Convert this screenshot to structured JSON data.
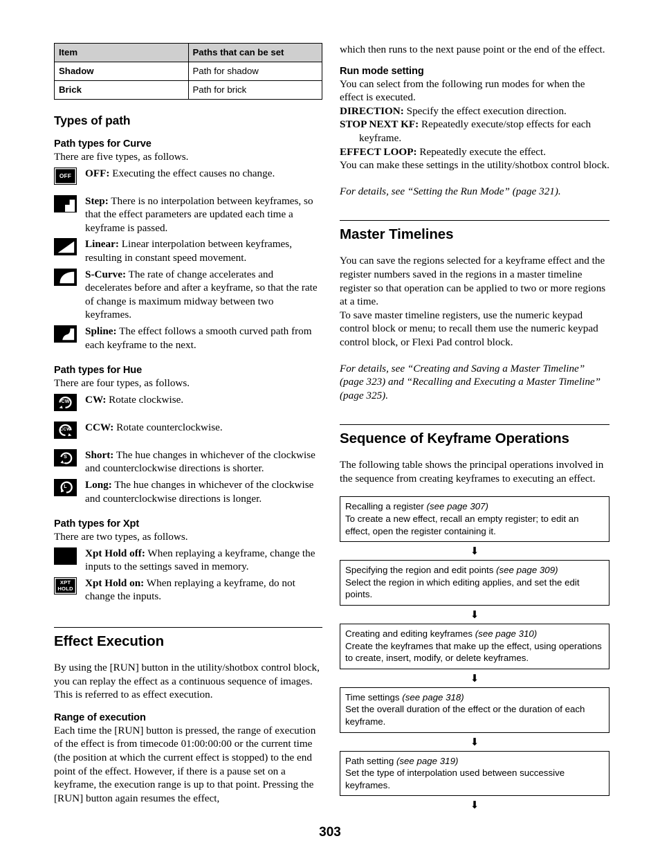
{
  "page_number": "303",
  "table": {
    "headers": [
      "Item",
      "Paths that can be set"
    ],
    "rows": [
      {
        "item": "Shadow",
        "paths": "Path for shadow"
      },
      {
        "item": "Brick",
        "paths": "Path for brick"
      }
    ]
  },
  "types_of_path": {
    "heading": "Types of path",
    "curve": {
      "heading": "Path types for Curve",
      "intro": "There are five types, as follows.",
      "items": [
        {
          "icon": "off-icon",
          "icon_label": "OFF",
          "term": "OFF:",
          "desc": " Executing the effect causes no change."
        },
        {
          "icon": "step-path-icon",
          "icon_label": "",
          "term": "Step:",
          "desc": " There is no interpolation between keyframes, so that the effect parameters are updated each time a keyframe is passed."
        },
        {
          "icon": "linear-path-icon",
          "icon_label": "",
          "term": "Linear:",
          "desc": " Linear interpolation between keyframes, resulting in constant speed movement."
        },
        {
          "icon": "s-curve-path-icon",
          "icon_label": "",
          "term": "S-Curve:",
          "desc": " The rate of change accelerates and decelerates before and after a keyframe, so that the rate of change is maximum midway between two keyframes."
        },
        {
          "icon": "spline-path-icon",
          "icon_label": "",
          "term": "Spline:",
          "desc": " The effect follows a smooth curved path from each keyframe to the next."
        }
      ]
    },
    "hue": {
      "heading": "Path types for Hue",
      "intro": "There are four types, as follows.",
      "items": [
        {
          "icon": "cw-rotate-icon",
          "icon_label": "CW",
          "term": "CW:",
          "desc": " Rotate clockwise."
        },
        {
          "icon": "ccw-rotate-icon",
          "icon_label": "CCW",
          "term": "CCW:",
          "desc": " Rotate counterclockwise."
        },
        {
          "icon": "short-hue-icon",
          "icon_label": "S",
          "term": "Short:",
          "desc": " The hue changes in whichever of the clockwise and counterclockwise directions is shorter."
        },
        {
          "icon": "long-hue-icon",
          "icon_label": "L",
          "term": "Long:",
          "desc": " The hue changes in whichever of the clockwise and counterclockwise directions is longer."
        }
      ]
    },
    "xpt": {
      "heading": "Path types for Xpt",
      "intro": "There are two types, as follows.",
      "items": [
        {
          "icon": "xpt-hold-off-icon",
          "icon_label": "",
          "term": "Xpt Hold off:",
          "desc": " When replaying a keyframe, change the inputs to the settings saved in memory."
        },
        {
          "icon": "xpt-hold-on-icon",
          "icon_label": "XPT HOLD",
          "term": "Xpt Hold on:",
          "desc": " When replaying a keyframe, do not change the inputs."
        }
      ]
    }
  },
  "effect_execution": {
    "heading": "Effect Execution",
    "intro": "By using the [RUN] button in the utility/shotbox control block, you can replay the effect as a continuous sequence of images. This is referred to as effect execution.",
    "range": {
      "heading": "Range of execution",
      "text": "Each time the [RUN] button is pressed, the range of execution of the effect is from timecode 01:00:00:00 or the current time (the position at which the current effect is stopped) to the end point of the effect. However, if there is a pause set on a keyframe, the execution range is up to that point. Pressing the [RUN] button again resumes the effect,"
    }
  },
  "right_column": {
    "continuation": "which then runs to the next pause point or the end of the effect.",
    "run_mode": {
      "heading": "Run mode setting",
      "intro": "You can select from the following run modes for when the effect is executed.",
      "modes": [
        {
          "term": "DIRECTION:",
          "desc": " Specify the effect execution direction."
        },
        {
          "term": "STOP NEXT KF:",
          "desc": " Repeatedly execute/stop effects for each keyframe."
        },
        {
          "term": "EFFECT LOOP:",
          "desc": " Repeatedly execute the effect."
        }
      ],
      "outro": "You can make these settings in the utility/shotbox control block.",
      "reference": "For details, see “Setting the Run Mode” (page 321)."
    },
    "master_timelines": {
      "heading": "Master Timelines",
      "para1": "You can save the regions selected for a keyframe effect and the register numbers saved in the regions in a master timeline register so that operation can be applied to two or more regions at a time.",
      "para2": "To save master timeline registers, use the numeric keypad control block or menu; to recall them use the numeric keypad control block, or Flexi Pad control block.",
      "reference": "For details, see “Creating and Saving a Master Timeline” (page 323) and “Recalling and Executing a Master Timeline” (page 325)."
    },
    "sequence": {
      "heading": "Sequence of Keyframe Operations",
      "intro": "The following table shows the principal operations involved in the sequence from creating keyframes to executing an effect.",
      "arrow_glyph": "⬇",
      "steps": [
        {
          "title": "Recalling a register",
          "ref": "(see page 307)",
          "desc": "To create a new effect, recall an empty register; to edit an effect, open the register containing it."
        },
        {
          "title": "Specifying the region and edit points",
          "ref": "(see page 309)",
          "desc": "Select the region in which editing applies, and set the edit points."
        },
        {
          "title": "Creating and editing keyframes",
          "ref": "(see page 310)",
          "desc": "Create the keyframes that make up the effect, using operations to create, insert, modify, or delete keyframes."
        },
        {
          "title": "Time settings",
          "ref": "(see page 318)",
          "desc": "Set the overall duration of the effect or the duration of each keyframe."
        },
        {
          "title": "Path setting",
          "ref": "(see page 319)",
          "desc": "Set the type of interpolation used between successive keyframes."
        }
      ]
    }
  }
}
